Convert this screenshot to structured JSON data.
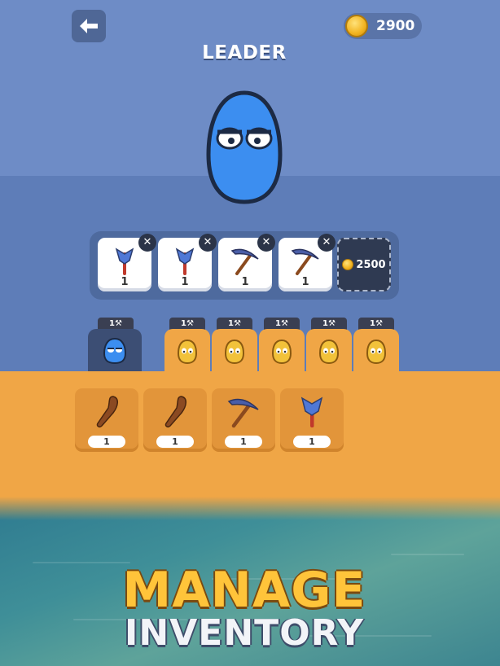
{
  "header": {
    "back_icon": "arrow-left-icon",
    "coins": "2900",
    "coin_icon": "coin-icon",
    "title": "LEADER"
  },
  "leader": {
    "character": "blue-blob",
    "color": "#3c8ef0"
  },
  "equipped_slots": [
    {
      "item": "axe",
      "count": "1"
    },
    {
      "item": "axe",
      "count": "1"
    },
    {
      "item": "pickaxe",
      "count": "1"
    },
    {
      "item": "pickaxe",
      "count": "1"
    }
  ],
  "buy_slot": {
    "price": "2500"
  },
  "character_tabs": [
    {
      "badge": "1⚒",
      "type": "blue-blob",
      "selected": true
    },
    {
      "badge": "1⚒",
      "type": "yellow-blob",
      "selected": false
    },
    {
      "badge": "1⚒",
      "type": "yellow-blob",
      "selected": false
    },
    {
      "badge": "1⚒",
      "type": "yellow-blob",
      "selected": false
    },
    {
      "badge": "1⚒",
      "type": "yellow-blob",
      "selected": false
    },
    {
      "badge": "1⚒",
      "type": "yellow-blob",
      "selected": false
    }
  ],
  "inventory": [
    {
      "item": "club",
      "count": "1"
    },
    {
      "item": "club",
      "count": "1"
    },
    {
      "item": "pickaxe",
      "count": "1"
    },
    {
      "item": "axe",
      "count": "1"
    }
  ],
  "banner": {
    "line1": "MANAGE",
    "line2": "INVENTORY"
  },
  "colors": {
    "top": "#6e8cc6",
    "mid": "#5e7db8",
    "orange": "#f0a646",
    "accent": "#ffc43a"
  }
}
